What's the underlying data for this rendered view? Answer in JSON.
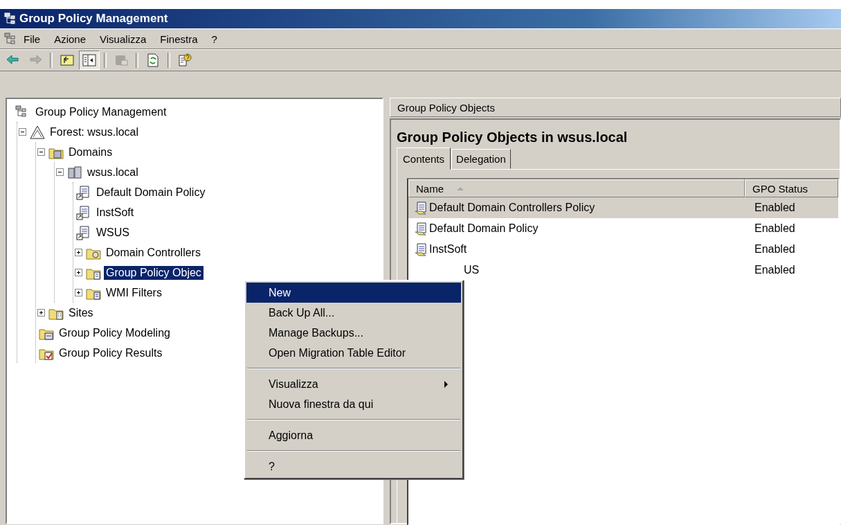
{
  "window": {
    "title": "Group Policy Management"
  },
  "menu_bar": [
    "File",
    "Azione",
    "Visualizza",
    "Finestra",
    "?"
  ],
  "toolbar": [
    {
      "kind": "back",
      "disabled": false,
      "pressed": false
    },
    {
      "kind": "forward",
      "disabled": true,
      "pressed": false
    },
    {
      "kind": "up",
      "disabled": false,
      "pressed": false
    },
    {
      "kind": "tree",
      "disabled": false,
      "pressed": true
    },
    {
      "kind": "export",
      "disabled": true,
      "pressed": false
    },
    {
      "kind": "refresh",
      "disabled": false,
      "pressed": false
    },
    {
      "kind": "help",
      "disabled": false,
      "pressed": false
    }
  ],
  "tree": [
    {
      "label": "Group Policy Management",
      "kind": "root",
      "selected": false,
      "children": [
        {
          "label": "Forest: wsus.local",
          "kind": "forest",
          "expanded": true,
          "selected": false,
          "children": [
            {
              "label": "Domains",
              "kind": "domains",
              "expanded": true,
              "selected": false,
              "children": [
                {
                  "label": "wsus.local",
                  "kind": "domain",
                  "expanded": true,
                  "selected": false,
                  "children": [
                    {
                      "label": "Default Domain Policy",
                      "kind": "gpo-link",
                      "selected": false
                    },
                    {
                      "label": "InstSoft",
                      "kind": "gpo-link",
                      "selected": false
                    },
                    {
                      "label": "WSUS",
                      "kind": "gpo-link",
                      "selected": false
                    },
                    {
                      "label": "Domain Controllers",
                      "kind": "ou",
                      "expanded": false,
                      "selected": false
                    },
                    {
                      "label": "Group Policy Objec",
                      "kind": "gpo-folder",
                      "expanded": false,
                      "selected": true
                    },
                    {
                      "label": "WMI Filters",
                      "kind": "wmi",
                      "expanded": false,
                      "selected": false
                    }
                  ]
                }
              ]
            },
            {
              "label": "Sites",
              "kind": "sites",
              "expanded": false,
              "selected": false
            },
            {
              "label": "Group Policy Modeling",
              "kind": "modeling",
              "selected": false
            },
            {
              "label": "Group Policy Results",
              "kind": "results",
              "selected": false
            }
          ]
        }
      ]
    }
  ],
  "context_menu": [
    {
      "kind": "item",
      "label": "New",
      "selected": true
    },
    {
      "kind": "item",
      "label": "Back Up All...",
      "selected": false
    },
    {
      "kind": "item",
      "label": "Manage Backups...",
      "selected": false
    },
    {
      "kind": "item",
      "label": "Open Migration Table Editor",
      "selected": false
    },
    {
      "kind": "separator"
    },
    {
      "kind": "submenu",
      "label": "Visualizza",
      "selected": false
    },
    {
      "kind": "item",
      "label": "Nuova finestra da qui",
      "selected": false
    },
    {
      "kind": "separator"
    },
    {
      "kind": "item",
      "label": "Aggiorna",
      "selected": false
    },
    {
      "kind": "separator"
    },
    {
      "kind": "item",
      "label": "?",
      "selected": false
    }
  ],
  "right_pane": {
    "header": "Group Policy Objects",
    "title": "Group Policy Objects in wsus.local",
    "tabs": [
      {
        "label": "Contents",
        "selected": true
      },
      {
        "label": "Delegation",
        "selected": false
      }
    ],
    "table": {
      "columns": [
        "Name",
        "GPO Status"
      ],
      "rows": [
        {
          "kind": "policy",
          "name": "Default Domain Controllers Policy",
          "status": "Enabled",
          "selected": true
        },
        {
          "kind": "policy",
          "name": "Default Domain Policy",
          "status": "Enabled",
          "selected": false
        },
        {
          "kind": "policy",
          "name": "InstSoft",
          "status": "Enabled",
          "selected": false
        },
        {
          "kind": "covered",
          "name": "US",
          "status": "Enabled",
          "selected": false
        }
      ]
    }
  }
}
